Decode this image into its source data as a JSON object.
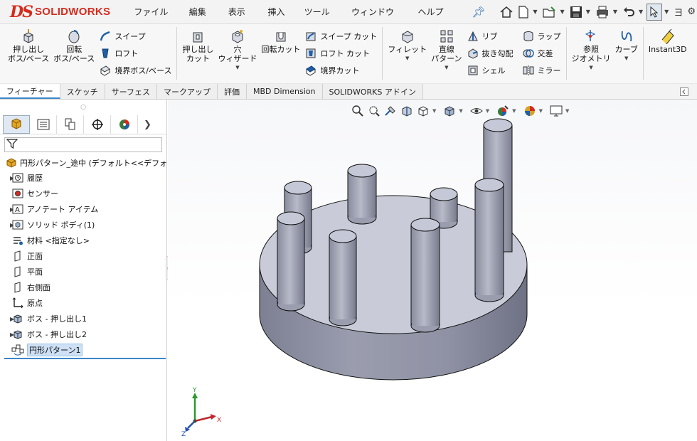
{
  "app": {
    "logo_mark": "DS",
    "logo_text": "SOLIDWORKS",
    "menu": [
      "ファイル(F)",
      "編集(E)",
      "表示(V)",
      "挿入(I)",
      "ツール(T)",
      "ウィンドウ(W)",
      "ヘルプ(H)"
    ],
    "quick_icons": [
      "home-icon",
      "new-document-icon",
      "open-icon",
      "save-icon",
      "print-icon",
      "undo-icon",
      "select-icon"
    ],
    "quick_partial": "ヨ"
  },
  "ribbon": {
    "extrude_boss": "押し出し\nボス/ベース",
    "revolve_boss": "回転\nボス/ベース",
    "sweep": "スイープ",
    "loft": "ロフト",
    "boundary_boss": "境界ボス/ベース",
    "extrude_cut": "押し出し\nカット",
    "hole_wizard": "穴\nウィザード",
    "revolve_cut": "回転カット",
    "sweep_cut": "スイープ カット",
    "loft_cut": "ロフト カット",
    "boundary_cut": "境界カット",
    "fillet": "フィレット",
    "linear_pattern": "直線\nパターン",
    "rib": "リブ",
    "draft": "抜き勾配",
    "shell": "シェル",
    "wrap": "ラップ",
    "intersect": "交差",
    "mirror": "ミラー",
    "ref_geometry": "参照\nジオメトリ",
    "curves": "カーブ",
    "instant3d": "Instant3D"
  },
  "tabs": [
    "フィーチャー",
    "スケッチ",
    "サーフェス",
    "マークアップ",
    "評価",
    "MBD Dimension",
    "SOLIDWORKS アドイン"
  ],
  "active_tab": "フィーチャー",
  "tree": {
    "root": "円形パターン_途中  (デフォルト<<デフォルト>_",
    "items": [
      {
        "label": "履歴",
        "icon": "history-folder-icon",
        "expandable": true
      },
      {
        "label": "センサー",
        "icon": "sensor-icon",
        "expandable": false
      },
      {
        "label": "アノテート アイテム",
        "icon": "annotation-icon",
        "expandable": true
      },
      {
        "label": "ソリッド ボディ(1)",
        "icon": "solid-body-folder-icon",
        "expandable": true
      },
      {
        "label": "材料 <指定なし>",
        "icon": "material-icon",
        "expandable": false
      },
      {
        "label": "正面",
        "icon": "plane-icon",
        "expandable": false
      },
      {
        "label": "平面",
        "icon": "plane-icon",
        "expandable": false
      },
      {
        "label": "右側面",
        "icon": "plane-icon",
        "expandable": false
      },
      {
        "label": "原点",
        "icon": "origin-icon",
        "expandable": false
      },
      {
        "label": "ボス - 押し出し1",
        "icon": "extrude-feature-icon",
        "expandable": true
      },
      {
        "label": "ボス - 押し出し2",
        "icon": "extrude-feature-icon",
        "expandable": true
      },
      {
        "label": "円形パターン1",
        "icon": "circular-pattern-icon",
        "expandable": false,
        "selected": true
      }
    ]
  },
  "triad": {
    "x": "X",
    "y": "Y",
    "z": "Z"
  },
  "colors": {
    "accent": "#3a86c8",
    "brand": "#d52b1e",
    "model_top": "#c9ccd8",
    "model_side": "#8d90a2"
  }
}
